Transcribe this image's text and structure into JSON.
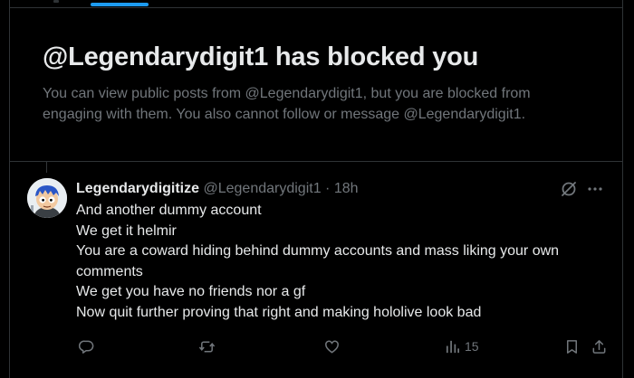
{
  "blocked": {
    "title": "@Legendarydigit1 has blocked you",
    "description_line1": "You can view public posts from @Legendarydigit1, but you are blocked from",
    "description_line2": "engaging with them. You also cannot follow or message @Legendarydigit1."
  },
  "tweet": {
    "display_name": "Legendarydigitize",
    "handle": "@Legendarydigit1",
    "separator": "·",
    "time": "18h",
    "lines": [
      "And another dummy account",
      "We get it helmir",
      "You are a coward hiding behind dummy accounts and mass liking your own",
      "comments",
      "We get you have no friends nor a gf",
      "Now quit further proving that right and making hololive look bad"
    ],
    "views_count": "15"
  },
  "colors": {
    "background": "#000000",
    "primary_text": "#e7e9ea",
    "secondary_text": "#71767b",
    "border": "#2f3336",
    "accent": "#1d9bf0"
  },
  "icons": [
    "grok-icon",
    "more-icon",
    "reply-icon",
    "repost-icon",
    "like-icon",
    "views-icon",
    "bookmark-icon",
    "share-icon"
  ]
}
